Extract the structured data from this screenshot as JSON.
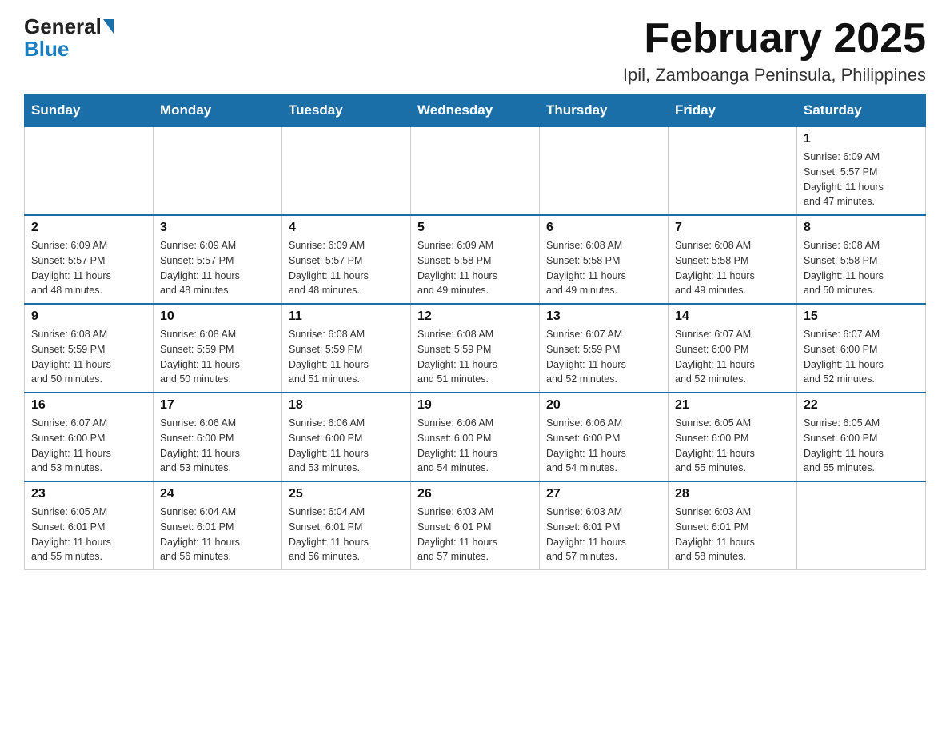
{
  "logo": {
    "top": "General",
    "bottom": "Blue"
  },
  "title": {
    "month_year": "February 2025",
    "location": "Ipil, Zamboanga Peninsula, Philippines"
  },
  "weekdays": [
    "Sunday",
    "Monday",
    "Tuesday",
    "Wednesday",
    "Thursday",
    "Friday",
    "Saturday"
  ],
  "weeks": [
    [
      {
        "day": "",
        "info": ""
      },
      {
        "day": "",
        "info": ""
      },
      {
        "day": "",
        "info": ""
      },
      {
        "day": "",
        "info": ""
      },
      {
        "day": "",
        "info": ""
      },
      {
        "day": "",
        "info": ""
      },
      {
        "day": "1",
        "info": "Sunrise: 6:09 AM\nSunset: 5:57 PM\nDaylight: 11 hours\nand 47 minutes."
      }
    ],
    [
      {
        "day": "2",
        "info": "Sunrise: 6:09 AM\nSunset: 5:57 PM\nDaylight: 11 hours\nand 48 minutes."
      },
      {
        "day": "3",
        "info": "Sunrise: 6:09 AM\nSunset: 5:57 PM\nDaylight: 11 hours\nand 48 minutes."
      },
      {
        "day": "4",
        "info": "Sunrise: 6:09 AM\nSunset: 5:57 PM\nDaylight: 11 hours\nand 48 minutes."
      },
      {
        "day": "5",
        "info": "Sunrise: 6:09 AM\nSunset: 5:58 PM\nDaylight: 11 hours\nand 49 minutes."
      },
      {
        "day": "6",
        "info": "Sunrise: 6:08 AM\nSunset: 5:58 PM\nDaylight: 11 hours\nand 49 minutes."
      },
      {
        "day": "7",
        "info": "Sunrise: 6:08 AM\nSunset: 5:58 PM\nDaylight: 11 hours\nand 49 minutes."
      },
      {
        "day": "8",
        "info": "Sunrise: 6:08 AM\nSunset: 5:58 PM\nDaylight: 11 hours\nand 50 minutes."
      }
    ],
    [
      {
        "day": "9",
        "info": "Sunrise: 6:08 AM\nSunset: 5:59 PM\nDaylight: 11 hours\nand 50 minutes."
      },
      {
        "day": "10",
        "info": "Sunrise: 6:08 AM\nSunset: 5:59 PM\nDaylight: 11 hours\nand 50 minutes."
      },
      {
        "day": "11",
        "info": "Sunrise: 6:08 AM\nSunset: 5:59 PM\nDaylight: 11 hours\nand 51 minutes."
      },
      {
        "day": "12",
        "info": "Sunrise: 6:08 AM\nSunset: 5:59 PM\nDaylight: 11 hours\nand 51 minutes."
      },
      {
        "day": "13",
        "info": "Sunrise: 6:07 AM\nSunset: 5:59 PM\nDaylight: 11 hours\nand 52 minutes."
      },
      {
        "day": "14",
        "info": "Sunrise: 6:07 AM\nSunset: 6:00 PM\nDaylight: 11 hours\nand 52 minutes."
      },
      {
        "day": "15",
        "info": "Sunrise: 6:07 AM\nSunset: 6:00 PM\nDaylight: 11 hours\nand 52 minutes."
      }
    ],
    [
      {
        "day": "16",
        "info": "Sunrise: 6:07 AM\nSunset: 6:00 PM\nDaylight: 11 hours\nand 53 minutes."
      },
      {
        "day": "17",
        "info": "Sunrise: 6:06 AM\nSunset: 6:00 PM\nDaylight: 11 hours\nand 53 minutes."
      },
      {
        "day": "18",
        "info": "Sunrise: 6:06 AM\nSunset: 6:00 PM\nDaylight: 11 hours\nand 53 minutes."
      },
      {
        "day": "19",
        "info": "Sunrise: 6:06 AM\nSunset: 6:00 PM\nDaylight: 11 hours\nand 54 minutes."
      },
      {
        "day": "20",
        "info": "Sunrise: 6:06 AM\nSunset: 6:00 PM\nDaylight: 11 hours\nand 54 minutes."
      },
      {
        "day": "21",
        "info": "Sunrise: 6:05 AM\nSunset: 6:00 PM\nDaylight: 11 hours\nand 55 minutes."
      },
      {
        "day": "22",
        "info": "Sunrise: 6:05 AM\nSunset: 6:00 PM\nDaylight: 11 hours\nand 55 minutes."
      }
    ],
    [
      {
        "day": "23",
        "info": "Sunrise: 6:05 AM\nSunset: 6:01 PM\nDaylight: 11 hours\nand 55 minutes."
      },
      {
        "day": "24",
        "info": "Sunrise: 6:04 AM\nSunset: 6:01 PM\nDaylight: 11 hours\nand 56 minutes."
      },
      {
        "day": "25",
        "info": "Sunrise: 6:04 AM\nSunset: 6:01 PM\nDaylight: 11 hours\nand 56 minutes."
      },
      {
        "day": "26",
        "info": "Sunrise: 6:03 AM\nSunset: 6:01 PM\nDaylight: 11 hours\nand 57 minutes."
      },
      {
        "day": "27",
        "info": "Sunrise: 6:03 AM\nSunset: 6:01 PM\nDaylight: 11 hours\nand 57 minutes."
      },
      {
        "day": "28",
        "info": "Sunrise: 6:03 AM\nSunset: 6:01 PM\nDaylight: 11 hours\nand 58 minutes."
      },
      {
        "day": "",
        "info": ""
      }
    ]
  ]
}
